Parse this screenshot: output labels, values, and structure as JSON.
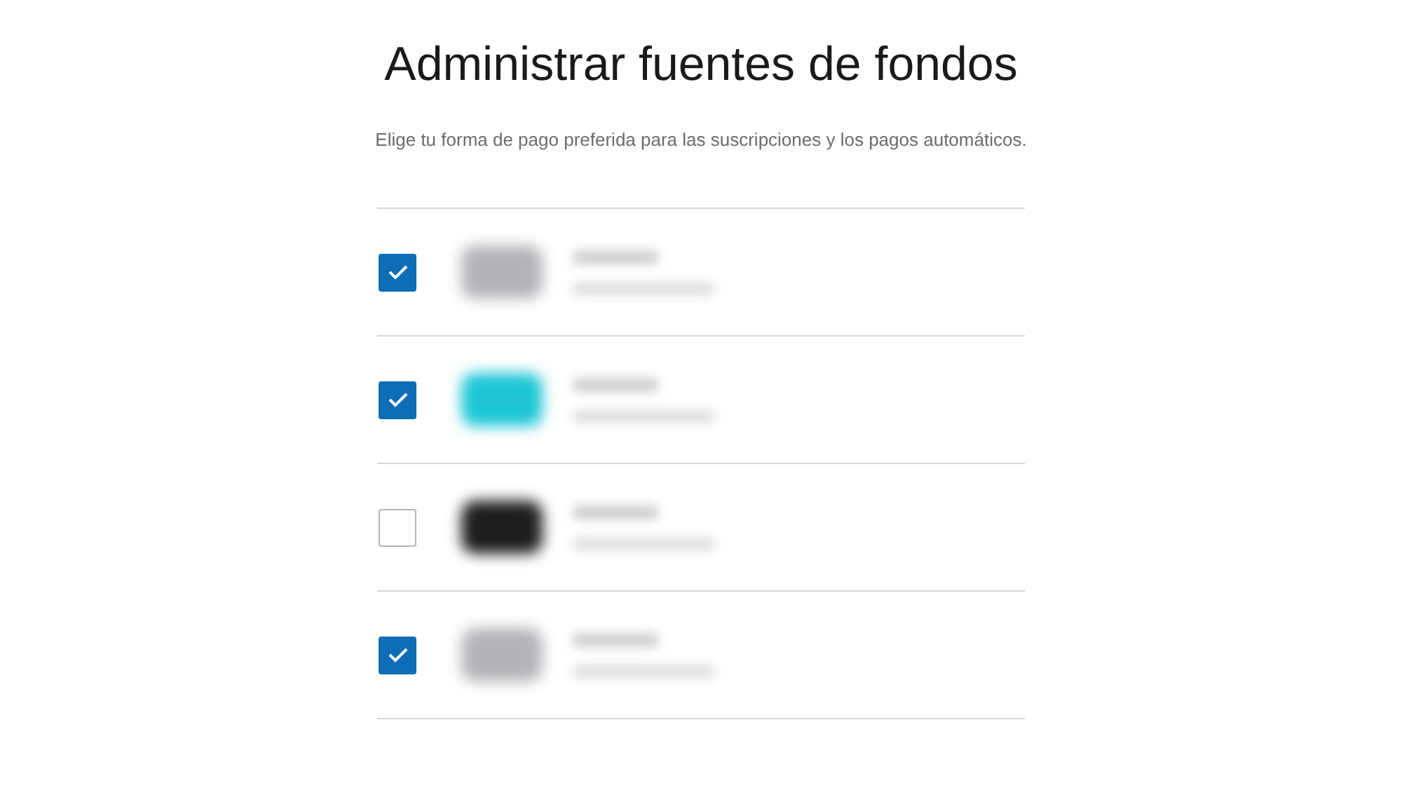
{
  "title": "Administrar fuentes de fondos",
  "subtitle": "Elige tu forma de pago preferida para las suscripciones y los pagos automáticos.",
  "methods": [
    {
      "checked": true,
      "color": "#b4b4b8"
    },
    {
      "checked": true,
      "color": "#1cc6d6"
    },
    {
      "checked": false,
      "color": "#1e1e1e"
    },
    {
      "checked": true,
      "color": "#b4b4b8"
    }
  ]
}
